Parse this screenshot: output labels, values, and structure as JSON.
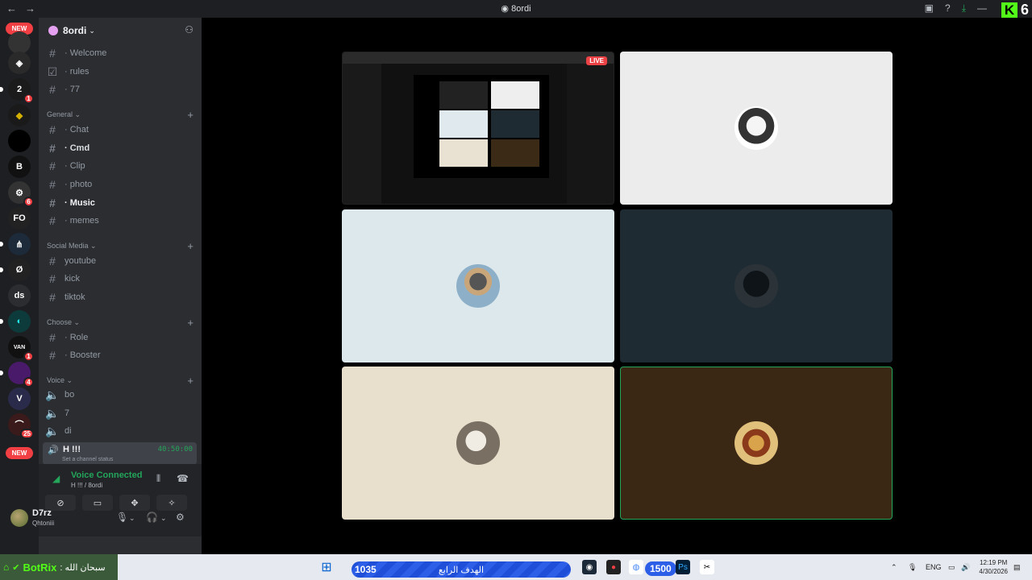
{
  "window": {
    "title": "8ordi"
  },
  "kick_overlay": {
    "count": "6"
  },
  "guild_bar": {
    "new_label_top": "NEW",
    "new_label_bottom": "NEW",
    "badges": [
      "1",
      "6",
      "1",
      "4",
      "25"
    ],
    "text_guild": "ds"
  },
  "server": {
    "name": "8ordi"
  },
  "channels": {
    "top": [
      {
        "label": "· Welcome"
      },
      {
        "label": "· rules"
      },
      {
        "label": "· 77"
      }
    ],
    "general": {
      "label": "General",
      "items": [
        {
          "label": "· Chat"
        },
        {
          "label": "· Cmd"
        },
        {
          "label": "· Clip"
        },
        {
          "label": "· photo"
        },
        {
          "label": "· Music"
        },
        {
          "label": "· memes"
        }
      ]
    },
    "social": {
      "label": "Social Media",
      "items": [
        {
          "label": "youtube"
        },
        {
          "label": "kick"
        },
        {
          "label": "tiktok"
        }
      ]
    },
    "choose": {
      "label": "Choose",
      "items": [
        {
          "label": "· Role"
        },
        {
          "label": "· Booster"
        }
      ]
    },
    "voice": {
      "label": "Voice",
      "items": [
        {
          "label": "bo"
        },
        {
          "label": "7"
        },
        {
          "label": "di"
        }
      ],
      "active": {
        "name": "H !!!",
        "timer": "40:50:00",
        "status": "Set a channel status"
      }
    }
  },
  "voice_panel": {
    "title": "Voice Connected",
    "subtitle": "H !!! / 8ordi"
  },
  "user": {
    "name": "D7rz",
    "status": "Qhtoniii"
  },
  "stream": {
    "live_label": "LIVE"
  },
  "taskbar": {
    "bot_name": "BotRix",
    "bot_message": ": سبحان الله",
    "goal_current": "1035",
    "goal_label": "الهدف الرابع",
    "goal_target": "1500",
    "lang": "ENG",
    "time": "12:19 PM",
    "date": "4/30/2026"
  },
  "colors": {
    "discord_bg": "#2b2d31",
    "guild_bg": "#1e1f22",
    "online_green": "#23a55a",
    "kick_green": "#53fc18",
    "alert_red": "#f23f43"
  }
}
